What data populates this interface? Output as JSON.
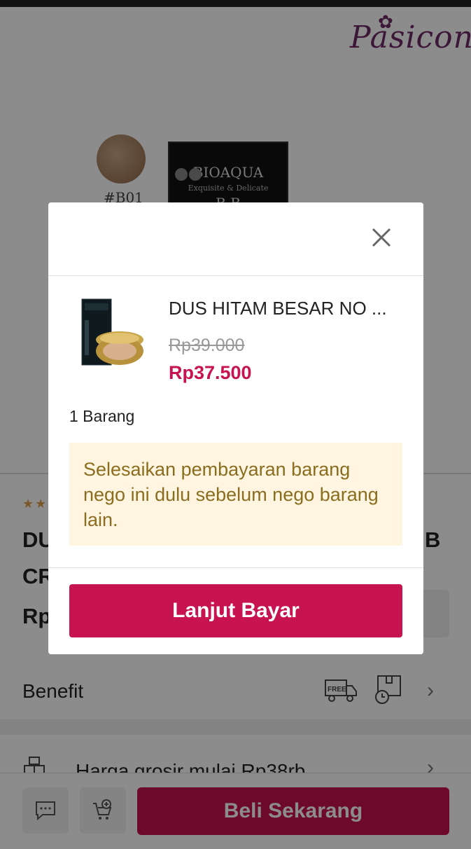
{
  "brand": {
    "logo_text": "Pasicon"
  },
  "hero": {
    "swatch_label": "#B01",
    "box_brand": "BIOAQUA",
    "box_subtitle": "Exquisite & Delicate",
    "box_model": "B.B"
  },
  "product": {
    "title_visible": "DU",
    "title_visible_2": "CR",
    "title_right": "B",
    "price_visible": "Rp",
    "stars": "★★"
  },
  "benefit": {
    "label": "Benefit",
    "free_text": "FREE"
  },
  "grosir": {
    "label": "Harga grosir mulai Rp38rb"
  },
  "bottombar": {
    "buy_label": "Beli Sekarang"
  },
  "modal": {
    "title": "DUS HITAM BESAR NO ...",
    "old_price": "Rp39.000",
    "new_price": "Rp37.500",
    "quantity": "1 Barang",
    "notice": "Selesaikan pembayaran barang nego ini dulu sebelum nego barang lain.",
    "cta_label": "Lanjut Bayar"
  },
  "colors": {
    "accent": "#c7134f",
    "notice_bg": "#fff5e0",
    "notice_text": "#8a6d1e",
    "brand_purple": "#6d2a67"
  }
}
